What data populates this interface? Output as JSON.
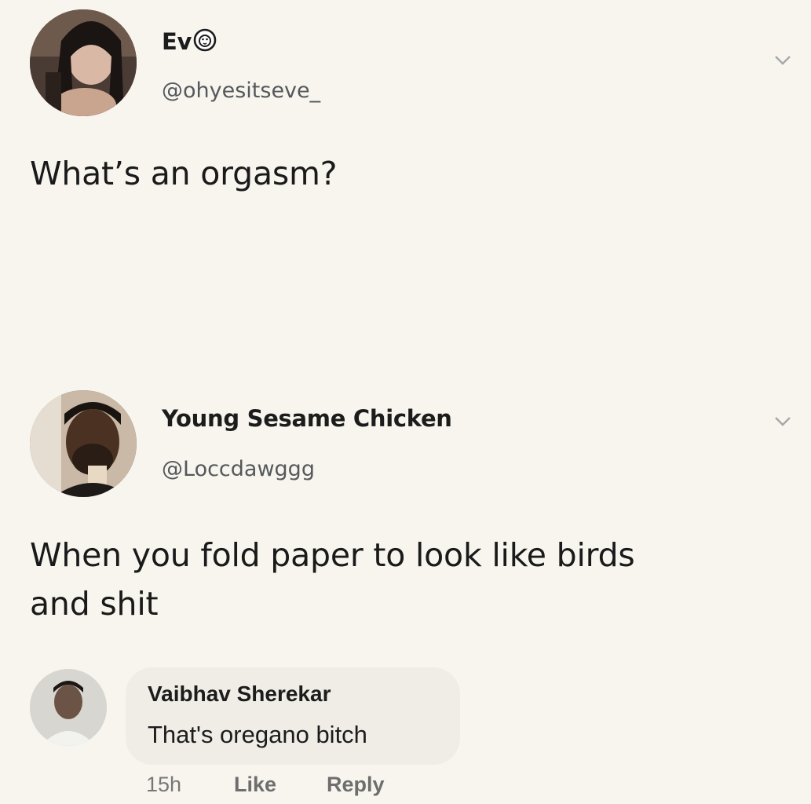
{
  "tweet1": {
    "name": "Ev",
    "name_emoji": "lion-face-emoji",
    "handle": "@ohyesitseve_",
    "text": "What’s an orgasm?"
  },
  "tweet2": {
    "name": "Young Sesame Chicken",
    "handle": "@Loccdawggg",
    "text_line1": "When you fold paper to look like birds",
    "text_line2": "and shit"
  },
  "comment": {
    "name": "Vaibhav Sherekar",
    "text": "That's oregano bitch",
    "time": "15h",
    "like_label": "Like",
    "reply_label": "Reply"
  },
  "icons": [
    "chevron-down-icon",
    "lion-face-emoji"
  ],
  "colors": {
    "background": "#f7f5ee",
    "handle": "#55585c",
    "bubble": "#efede6"
  }
}
